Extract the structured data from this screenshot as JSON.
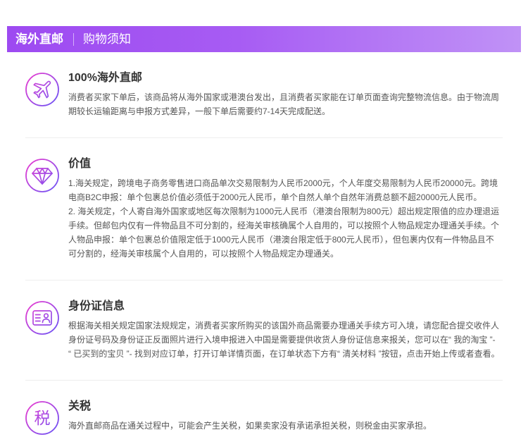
{
  "header": {
    "title": "海外直邮",
    "subtitle": "购物须知"
  },
  "colors": {
    "header_gradient_start": "#9d4af1",
    "header_gradient_end": "#c092f6",
    "icon_gradient_start": "#e03fd3",
    "icon_gradient_end": "#7552f2",
    "title_text": "#333333",
    "body_text": "#555555",
    "divider": "#eeeeee"
  },
  "sections": [
    {
      "icon": "airplane-icon",
      "title": "100%海外直邮",
      "lines": [
        "消费者买家下单后，该商品将从海外国家或港澳台发出，且消费者买家能在订单页面查询完整物流信息。由于物流周",
        "期较长运输距离与申报方式差异，一般下单后需要约7-14天完成配送。"
      ]
    },
    {
      "icon": "diamond-icon",
      "title": "价值",
      "lines": [
        "1.海关规定，跨境电子商务零售进口商品单次交易限制为人民币2000元，个人年度交易限制为人民币20000元。跨境",
        "电商B2C申报：单个包裹总价值必须低于2000元人民币，单个自然人单个自然年消费总额不超20000元人民币。",
        "2. 海关规定，个人寄自海外国家或地区每次限制为1000元人民币（港澳台限制为800元）超出规定限值的应办理退运",
        "手续。但邮包内仅有一件物品且不可分割的，经海关审核确属个人自用的，可以按照个人物品规定办理通关手续。个",
        "人物品申报：单个包裹总价值限定低于1000元人民币（港澳台限定低于800元人民币），但包裹内仅有一件物品且不",
        "可分割的，经海关审核属个人自用的，可以按照个人物品规定办理通关。"
      ]
    },
    {
      "icon": "id-card-icon",
      "title": "身份证信息",
      "lines": [
        "根据海关相关规定国家法规规定，消费者买家所购买的该国外商品需要办理通关手续方可入境，请您配合提交收件人",
        "身份证号码及身份证正反面照片进行入境申报进入中国是需要提供收货人身份证信息来报关，您可以在“ 我的淘宝 ”-",
        "“ 已买到的宝贝 ”- 找到对应订单，打开订单详情页面，在订单状态下方有“ 清关材料 ”按钮，点击开始上传或者查看。"
      ]
    },
    {
      "icon": "tax-character-icon",
      "icon_text": "税",
      "title": "关税",
      "lines": [
        "海外直邮商品在通关过程中，可能会产生关税，如果卖家没有承诺承担关税，则税金由买家承担。"
      ]
    }
  ]
}
